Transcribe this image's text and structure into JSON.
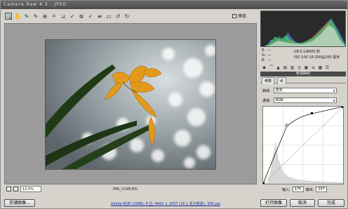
{
  "window": {
    "title": "Camera Raw 4.3 - JPEG"
  },
  "toolbar": {
    "tools": [
      {
        "name": "zoom-tool-icon",
        "glyph": "🔍"
      },
      {
        "name": "hand-tool-icon",
        "glyph": "✋"
      },
      {
        "name": "white-balance-tool-icon",
        "glyph": "✎"
      },
      {
        "name": "color-sampler-tool-icon",
        "glyph": "✎"
      },
      {
        "name": "targeted-adjust-tool-icon",
        "glyph": "⊕"
      },
      {
        "name": "crop-tool-icon",
        "glyph": "⌗"
      },
      {
        "name": "straighten-tool-icon",
        "glyph": "⊿"
      },
      {
        "name": "spot-removal-tool-icon",
        "glyph": "✓"
      },
      {
        "name": "red-eye-tool-icon",
        "glyph": "⊗"
      },
      {
        "name": "adjust-brush-icon",
        "glyph": "✓"
      },
      {
        "name": "list-icon",
        "glyph": "≡"
      },
      {
        "name": "preferences-icon",
        "glyph": "▭"
      },
      {
        "name": "rotate-left-icon",
        "glyph": "↺"
      },
      {
        "name": "rotate-right-icon",
        "glyph": "↻"
      }
    ],
    "preview_label": "预览",
    "preview_checked": true
  },
  "status": {
    "zoom": "12.5%",
    "filename": "IMG_0198.JPG"
  },
  "footer": {
    "save_label": "存储图像...",
    "workflow_link": "Adobe RGB (1998); 8 位; 4662 × 3437 (16.1 百万像素); 300 ppi",
    "open_label": "打开图像",
    "cancel_label": "取消",
    "done_label": "完成"
  },
  "info": {
    "r_label": "R:",
    "g_label": "G:",
    "b_label": "B:",
    "exposure": "f/8.0   1/8000 秒",
    "iso": "ISO 100   18-200@200 毫米",
    "r_val": "---",
    "g_val": "---",
    "b_val": "---"
  },
  "panel": {
    "title": "色调曲线",
    "tabs": [
      "参数",
      "点"
    ],
    "curve_label": "曲线:",
    "curve_value": "自定",
    "channel_label": "通道:",
    "channel_value": "RGB",
    "input_label": "输入:",
    "input_value": "175",
    "output_label": "输出:",
    "output_value": "207"
  },
  "colors": {
    "titlebar": "#4b4b4b",
    "stage": "#9c9c9c",
    "petal": "#e39a1c",
    "leaf": "#1f3b16",
    "link": "#1a2aa0"
  }
}
